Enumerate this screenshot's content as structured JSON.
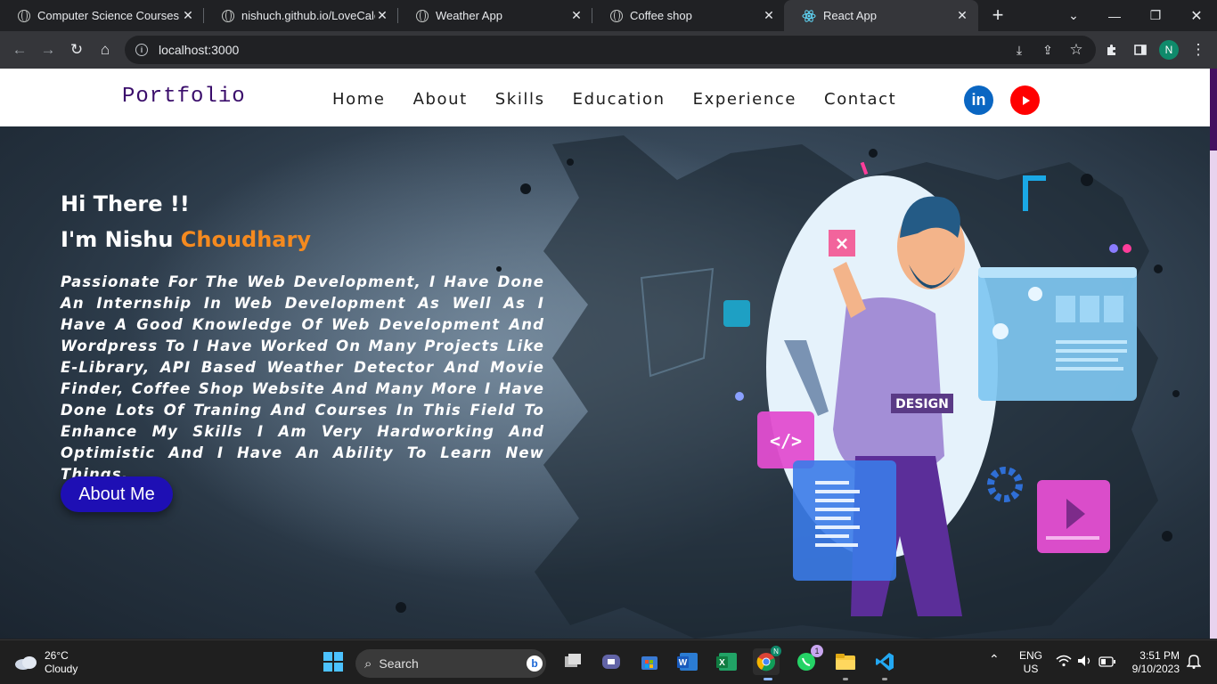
{
  "browser": {
    "tabs": [
      {
        "title": "Computer Science Courses o",
        "icon": "globe-icon"
      },
      {
        "title": "nishuch.github.io/LoveCalcul",
        "icon": "globe-icon"
      },
      {
        "title": "Weather App",
        "icon": "globe-icon"
      },
      {
        "title": "Coffee shop",
        "icon": "globe-icon"
      },
      {
        "title": "React App",
        "icon": "react-icon",
        "active": true
      }
    ],
    "url": "localhost:3000",
    "profile_initial": "N"
  },
  "site": {
    "brand": "Portfolio",
    "nav": [
      "Home",
      "About",
      "Skills",
      "Education",
      "Experience",
      "Contact"
    ],
    "social": [
      "linkedin-icon",
      "youtube-icon"
    ],
    "hero": {
      "greeting": "Hi There !!",
      "name_prefix": "I'm Nishu ",
      "name_accent": "Choudhary",
      "bio": "Passionate For The Web Development, I Have Done An Internship In Web Development As Well As I Have A Good Knowledge Of Web Development And Wordpress To I Have Worked On Many Projects Like E-Library, API Based Weather Detector And Movie Finder, Coffee Shop Website And Many More I Have Done Lots Of Traning And Courses In This Field To Enhance My Skills I Am Very Hardworking And Optimistic And I Have An Ability To Learn New Things.",
      "button": "About Me",
      "illustration_label": "DESIGN"
    },
    "colors": {
      "accent": "#f58a1f",
      "button": "#1e0fb4",
      "brand": "#3a0d6b"
    }
  },
  "taskbar": {
    "weather_temp": "26°C",
    "weather_desc": "Cloudy",
    "search_label": "Search",
    "whatsapp_badge": "1",
    "chrome_badge": "N",
    "lang_top": "ENG",
    "lang_bottom": "US",
    "time": "3:51 PM",
    "date": "9/10/2023"
  }
}
